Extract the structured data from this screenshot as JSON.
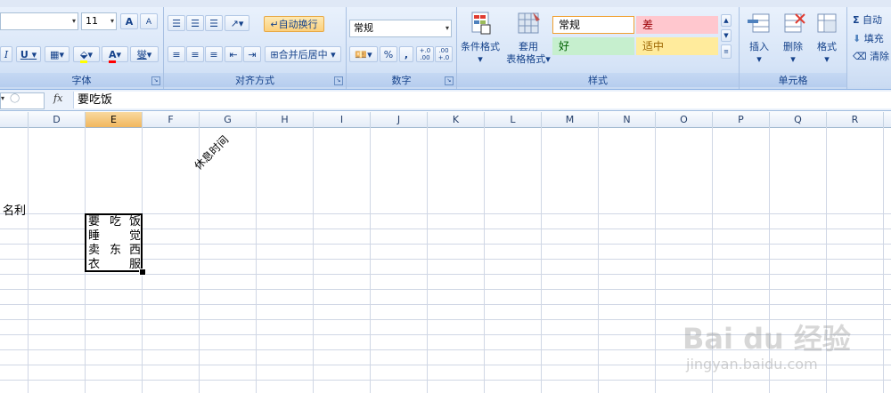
{
  "ribbon": {
    "font": {
      "font_size": "11",
      "grow_label": "A",
      "shrink_label": "A",
      "italic": "I",
      "underline": "U",
      "font_color_label": "A",
      "phonetic": "燮",
      "group_label": "字体"
    },
    "alignment": {
      "wrap_text": "自动换行",
      "merge_center": "合并后居中",
      "group_label": "对齐方式"
    },
    "number": {
      "format": "常规",
      "percent": "%",
      "comma": ",",
      "inc_decimal": "+.0 .00",
      "dec_decimal": ".00 +.0",
      "group_label": "数字"
    },
    "styles": {
      "conditional_format": "条件格式",
      "table_format_1": "套用",
      "table_format_2": "表格格式",
      "cell_styles": [
        {
          "label": "常规",
          "bg": "#ffffff",
          "color": "#000000",
          "border": "#f0a030"
        },
        {
          "label": "差",
          "bg": "#ffc7ce",
          "color": "#9c0006",
          "border": "#ffc7ce"
        },
        {
          "label": "好",
          "bg": "#c6efce",
          "color": "#006100",
          "border": "#c6efce"
        },
        {
          "label": "适中",
          "bg": "#ffeb9c",
          "color": "#9c6500",
          "border": "#ffeb9c"
        }
      ],
      "group_label": "样式"
    },
    "cells": {
      "insert": "插入",
      "delete": "删除",
      "format": "格式",
      "group_label": "单元格"
    },
    "editing": {
      "sigma": "Σ",
      "autosum": "自动",
      "fill": "填充",
      "clear": "清除"
    }
  },
  "formula_bar": {
    "fx": "fx",
    "content": "要吃饭"
  },
  "columns": [
    "D",
    "E",
    "F",
    "G",
    "H",
    "I",
    "J",
    "K",
    "L",
    "M",
    "N",
    "O",
    "P",
    "Q",
    "R"
  ],
  "selected_column": "E",
  "cells": {
    "c_partial": "名利",
    "g_rotated": "休息时间",
    "e_rows": [
      [
        "要",
        "吃",
        "饭"
      ],
      [
        "睡",
        "",
        "觉"
      ],
      [
        "卖",
        "东",
        "西"
      ],
      [
        "衣",
        "",
        "服"
      ]
    ]
  },
  "watermark": {
    "logo": "Bai du 经验",
    "url": "jingyan.baidu.com"
  }
}
